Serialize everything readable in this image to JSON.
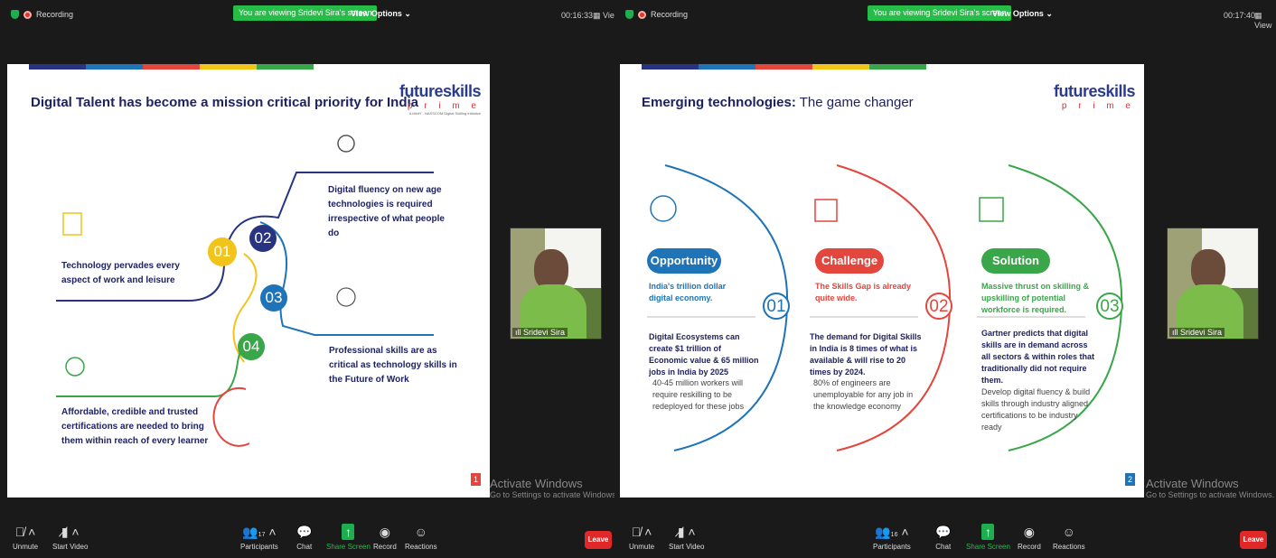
{
  "left": {
    "recording": "Recording",
    "banner": "You are viewing Sridevi Sira's screen",
    "view_options": "View Options ⌄",
    "timer": "00:16:33",
    "view": "View",
    "slide": {
      "title": "Digital Talent has become a mission critical priority for India",
      "logo_main": "futureskills",
      "logo_sub": "p r i m e",
      "logo_tag": "A MeitY - NASSCOM Digital Skilling Initiative",
      "items": [
        {
          "num": "01",
          "text": "Technology pervades every aspect of work and leisure",
          "color": "#f2c318"
        },
        {
          "num": "02",
          "text": "Digital fluency on new age technologies is required irrespective of what people do",
          "color": "#283480"
        },
        {
          "num": "03",
          "text": "Professional skills are as critical as technology skills in the Future of Work",
          "color": "#1f73b7"
        },
        {
          "num": "04",
          "text": "Affordable, credible and trusted certifications are needed to bring them within reach of every learner",
          "color": "#3aa64a"
        }
      ],
      "page": "1"
    },
    "participant": "Sridevi Sira",
    "activate": "Activate Windows",
    "activate_sub": "Go to Settings to activate Windows.",
    "controls": {
      "unmute": "Unmute",
      "start_video": "Start Video",
      "participants": "Participants",
      "participants_count": "17",
      "chat": "Chat",
      "share": "Share Screen",
      "record": "Record",
      "reactions": "Reactions",
      "leave": "Leave"
    }
  },
  "right": {
    "recording": "Recording",
    "banner": "You are viewing Sridevi Sira's screen",
    "view_options": "View Options ⌄",
    "timer": "00:17:40",
    "view": "View",
    "slide": {
      "title_bold": "Emerging technologies:",
      "title_rest": " The game changer",
      "logo_main": "futureskills",
      "logo_sub": "p r i m e",
      "cols": [
        {
          "num": "01",
          "pill": "Opportunity",
          "color": "#1f73b7",
          "head": "India's trillion dollar digital economy.",
          "bold": "Digital Ecosystems can create $1 trillion of Economic value & 65 million jobs in India by 2025",
          "body": "40-45 million workers will require reskilling to be redeployed for these jobs"
        },
        {
          "num": "02",
          "pill": "Challenge",
          "color": "#e2463d",
          "head": "The Skills Gap is already quite wide.",
          "bold": "The demand for Digital Skills in India is 8 times of what is available & will rise to 20 times by 2024.",
          "body": "80% of engineers are unemployable for any job in the knowledge economy"
        },
        {
          "num": "03",
          "pill": "Solution",
          "color": "#3aa64a",
          "head": "Massive thrust on skilling & upskilling of potential workforce is required.",
          "bold": "Gartner predicts that digital skills are in demand across all sectors & within roles that traditionally did not require them.",
          "body": "Develop digital fluency & build skills through industry aligned certifications to be industry ready"
        }
      ],
      "page": "2"
    },
    "participant": "Sridevi Sira",
    "activate": "Activate Windows",
    "activate_sub": "Go to Settings to activate Windows.",
    "controls": {
      "unmute": "Unmute",
      "start_video": "Start Video",
      "participants": "Participants",
      "participants_count": "16",
      "chat": "Chat",
      "share": "Share Screen",
      "record": "Record",
      "reactions": "Reactions",
      "leave": "Leave"
    }
  },
  "colors": {
    "accent_green": "#25bc48",
    "leave_red": "#e02828",
    "navy": "#1e2260"
  }
}
